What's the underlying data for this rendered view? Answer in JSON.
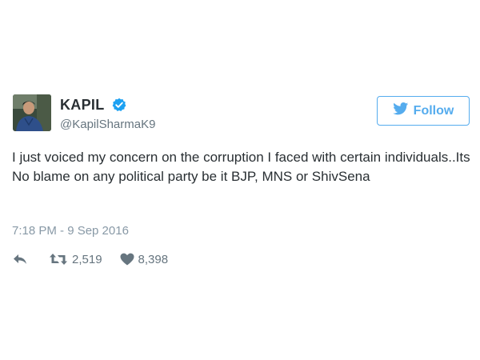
{
  "user": {
    "display_name": "KAPIL",
    "handle": "@KapilSharmaK9",
    "verified": true
  },
  "follow_button": {
    "label": "Follow",
    "icon": "twitter-bird-icon"
  },
  "tweet": {
    "text": "I just voiced my concern on the corruption I faced with certain individuals..Its No blame on any political party be it BJP, MNS or ShivSena",
    "timestamp": "7:18 PM - 9 Sep 2016"
  },
  "actions": {
    "reply_icon": "reply-icon",
    "retweet_icon": "retweet-icon",
    "retweet_count": "2,519",
    "like_icon": "heart-icon",
    "like_count": "8,398"
  },
  "colors": {
    "accent": "#55acee",
    "verified": "#1da1f2",
    "text": "#292f33",
    "muted": "#8899a6"
  }
}
